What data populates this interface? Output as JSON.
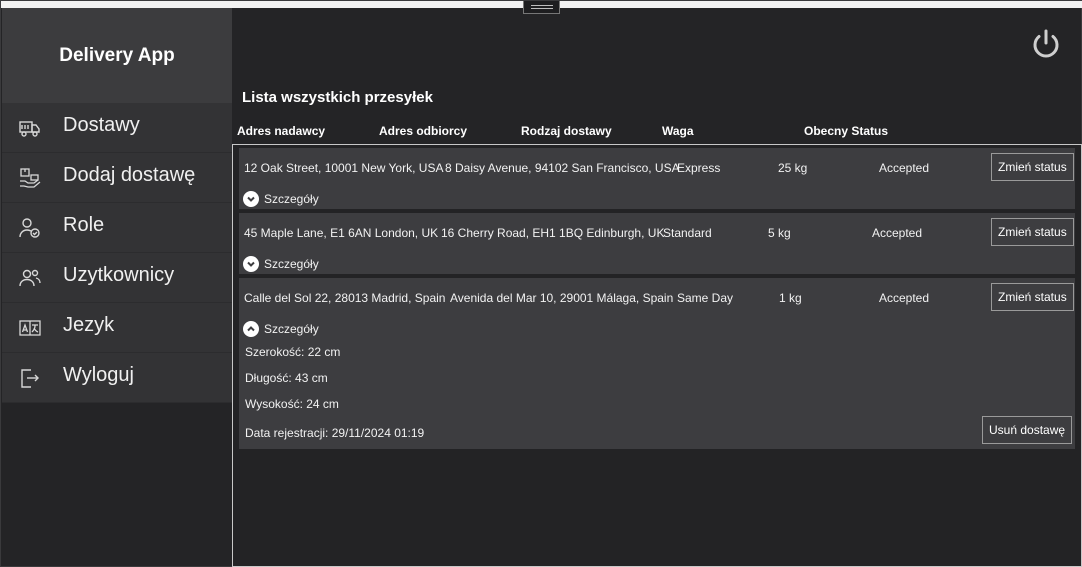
{
  "app": {
    "title": "Delivery App"
  },
  "nav": [
    {
      "label": "Dostawy",
      "icon": "truck-icon"
    },
    {
      "label": "Dodaj dostawę",
      "icon": "add-package-icon"
    },
    {
      "label": "Role",
      "icon": "user-role-icon"
    },
    {
      "label": "Uzytkownicy",
      "icon": "users-icon"
    },
    {
      "label": "Jezyk",
      "icon": "language-icon"
    },
    {
      "label": "Wyloguj",
      "icon": "logout-icon"
    }
  ],
  "header": {
    "power_icon": "power-icon"
  },
  "list": {
    "title": "Lista wszystkich przesyłek",
    "columns": {
      "sender": "Adres nadawcy",
      "receiver": "Adres odbiorcy",
      "type": "Rodzaj dostawy",
      "weight": "Waga",
      "status": "Obecny Status"
    },
    "change_status_label": "Zmień status",
    "details_label": "Szczegóły",
    "rows": [
      {
        "sender": "12 Oak Street, 10001 New York, USA",
        "receiver": "8 Daisy Avenue, 94102 San Francisco, USA",
        "type": "Express",
        "weight": "25 kg",
        "status": "Accepted",
        "expanded": false
      },
      {
        "sender": "45 Maple Lane, E1 6AN London, UK",
        "receiver": "16 Cherry Road, EH1 1BQ Edinburgh, UK",
        "type": "Standard",
        "weight": "5 kg",
        "status": "Accepted",
        "expanded": false
      },
      {
        "sender": "Calle del Sol 22, 28013 Madrid, Spain",
        "receiver": "Avenida del Mar 10, 29001 Málaga, Spain",
        "type": "Same Day",
        "weight": "1 kg",
        "status": "Accepted",
        "expanded": true,
        "details": {
          "width": "Szerokość: 22 cm",
          "length": "Długość: 43 cm",
          "height": "Wysokość: 24 cm",
          "registered": "Data rejestracji: 29/11/2024 01:19",
          "delete_label": "Usuń dostawę"
        }
      }
    ]
  }
}
